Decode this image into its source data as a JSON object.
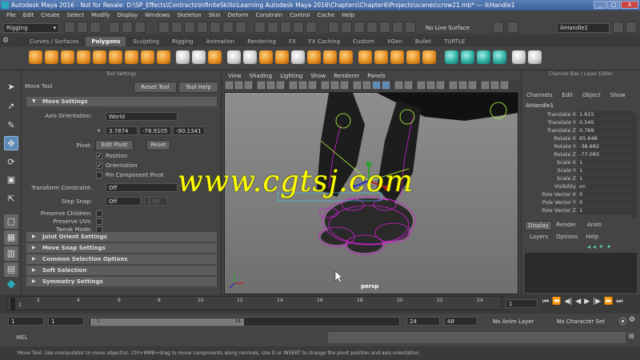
{
  "window": {
    "title": "Autodesk Maya 2016 - Not for Resale: D:\\SP_Effects\\Contracts\\InfiniteSkills\\Learning Autodesk Maya 2016\\Chapters\\Chapter6\\Projects\\scenes\\crow21.mb*  ---  ikHandle1",
    "controls": [
      "_",
      "□",
      "X"
    ]
  },
  "menubar": [
    "File",
    "Edit",
    "Create",
    "Select",
    "Modify",
    "Display",
    "Windows",
    "Skeleton",
    "Skin",
    "Deform",
    "Constrain",
    "Control",
    "Cache",
    "Help"
  ],
  "statusline": {
    "menuset": "Rigging",
    "live_surface": "No Live Surface",
    "object_name": "ikHandle1"
  },
  "shelf_tabs": [
    "Curves / Surfaces",
    "Polygons",
    "Sculpting",
    "Rigging",
    "Animation",
    "Rendering",
    "FX",
    "FX Caching",
    "Custom",
    "XGen",
    "Bullet",
    "TURTLE"
  ],
  "shelf_active": "Polygons",
  "tool_settings": {
    "panel_title": "Tool Settings",
    "tool_name": "Move Tool",
    "reset_button": "Reset Tool",
    "help_button": "Tool Help",
    "move_section": "Move Settings",
    "axis_orientation_label": "Axis Orientation:",
    "axis_orientation_value": "World",
    "coord_x": "3.7874",
    "coord_y": "-78.9105",
    "coord_z": "-90.1341",
    "pivot_label": "Pivot:",
    "edit_pivot": "Edit Pivot",
    "pivot_reset": "Reset",
    "position_label": "Position",
    "orientation_label": "Orientation",
    "pin_label": "Pin Component Pivot",
    "transform_constraint_label": "Transform Constraint:",
    "transform_constraint_value": "Off",
    "step_snap_label": "Step Snap:",
    "step_snap_value": "Off",
    "step_snap_amount": "1.00",
    "preserve_children": "Preserve Children:",
    "preserve_uvs": "Preserve UVs:",
    "tweak_mode": "Tweak Mode:",
    "sections": [
      "Joint Orient Settings",
      "Move Snap Settings",
      "Common Selection Options",
      "Soft Selection",
      "Symmetry Settings"
    ]
  },
  "viewport": {
    "menu": [
      "View",
      "Shading",
      "Lighting",
      "Show",
      "Renderer",
      "Panels"
    ],
    "camera_label": "persp",
    "watermark": "www.cgtsj.com"
  },
  "channel_box": {
    "panel_title": "Channel Box / Layer Editor",
    "menu": [
      "Channels",
      "Edit",
      "Object",
      "Show"
    ],
    "object": "ikHandle1",
    "channels": [
      {
        "name": "Translate X",
        "value": "1.615"
      },
      {
        "name": "Translate Y",
        "value": "0.545"
      },
      {
        "name": "Translate Z",
        "value": "0.769"
      },
      {
        "name": "Rotate X",
        "value": "65.648"
      },
      {
        "name": "Rotate Y",
        "value": "-36.682"
      },
      {
        "name": "Rotate Z",
        "value": "-77.083"
      },
      {
        "name": "Scale X",
        "value": "1"
      },
      {
        "name": "Scale Y",
        "value": "1"
      },
      {
        "name": "Scale Z",
        "value": "1"
      },
      {
        "name": "Visibility",
        "value": "on"
      },
      {
        "name": "Pole Vector X",
        "value": "0"
      },
      {
        "name": "Pole Vector Y",
        "value": "0"
      },
      {
        "name": "Pole Vector Z",
        "value": "1"
      }
    ],
    "layer_tabs": [
      "Display",
      "Render",
      "Anim"
    ],
    "layer_menu": [
      "Layers",
      "Options",
      "Help"
    ]
  },
  "timeline": {
    "ticks": [
      "1",
      "2",
      "4",
      "6",
      "8",
      "10",
      "12",
      "14",
      "16",
      "18",
      "20",
      "22",
      "24"
    ],
    "current_frame": "1"
  },
  "range": {
    "start": "1",
    "playback_start": "1",
    "slider_start": "1",
    "slider_end": "24",
    "playback_end": "24",
    "end": "48",
    "anim_layer": "No Anim Layer",
    "character_set": "No Character Set"
  },
  "command_line": {
    "label": "MEL"
  },
  "help_line": "Move Tool: Use manipulator to move object(s). Ctrl+MMB+drag to move components along normals. Use D or INSERT to change the pivot position and axis orientation.",
  "colors": {
    "accent_active_tool": "#5d8bb8",
    "watermark": "#ffff00",
    "maya_logo": "#2aa9b8"
  }
}
